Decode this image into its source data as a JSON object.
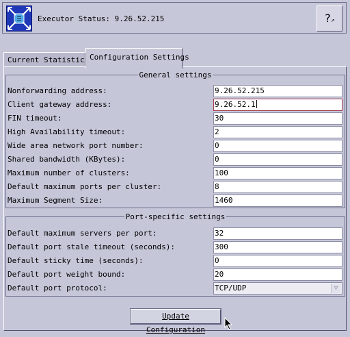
{
  "header": {
    "title": "Executor Status: 9.26.52.215",
    "help_label": "?"
  },
  "tabs": [
    {
      "label": "Current Statistics",
      "active": false
    },
    {
      "label": "Configuration Settings",
      "active": true
    }
  ],
  "general": {
    "legend": "General settings",
    "rows": [
      {
        "label": "Nonforwarding address:",
        "value": "9.26.52.215"
      },
      {
        "label": "Client gateway address:",
        "value": "9.26.52.1"
      },
      {
        "label": "FIN timeout:",
        "value": "30"
      },
      {
        "label": "High Availability timeout:",
        "value": "2"
      },
      {
        "label": "Wide area network port number:",
        "value": "0"
      },
      {
        "label": "Shared bandwidth (KBytes):",
        "value": "0"
      },
      {
        "label": "Maximum number of clusters:",
        "value": "100"
      },
      {
        "label": "Default maximum ports per cluster:",
        "value": "8"
      },
      {
        "label": "Maximum Segment Size:",
        "value": "1460"
      }
    ]
  },
  "port": {
    "legend": "Port-specific settings",
    "rows": [
      {
        "label": "Default maximum servers per port:",
        "value": "32"
      },
      {
        "label": "Default port stale timeout (seconds):",
        "value": "300"
      },
      {
        "label": "Default sticky time (seconds):",
        "value": "0"
      },
      {
        "label": "Default port weight bound:",
        "value": "20"
      },
      {
        "label": "Default port protocol:",
        "value": "TCP/UDP"
      }
    ]
  },
  "update_button": {
    "label": "Update Configuration"
  },
  "colors": {
    "background": "#c5c6d8",
    "app_icon": "#1f38b8",
    "focus_border": "#a63a4a"
  },
  "icons": {
    "app": "network-dispatcher-icon",
    "help": "help-pointer-icon",
    "dropdown": "triangle-down-icon"
  }
}
